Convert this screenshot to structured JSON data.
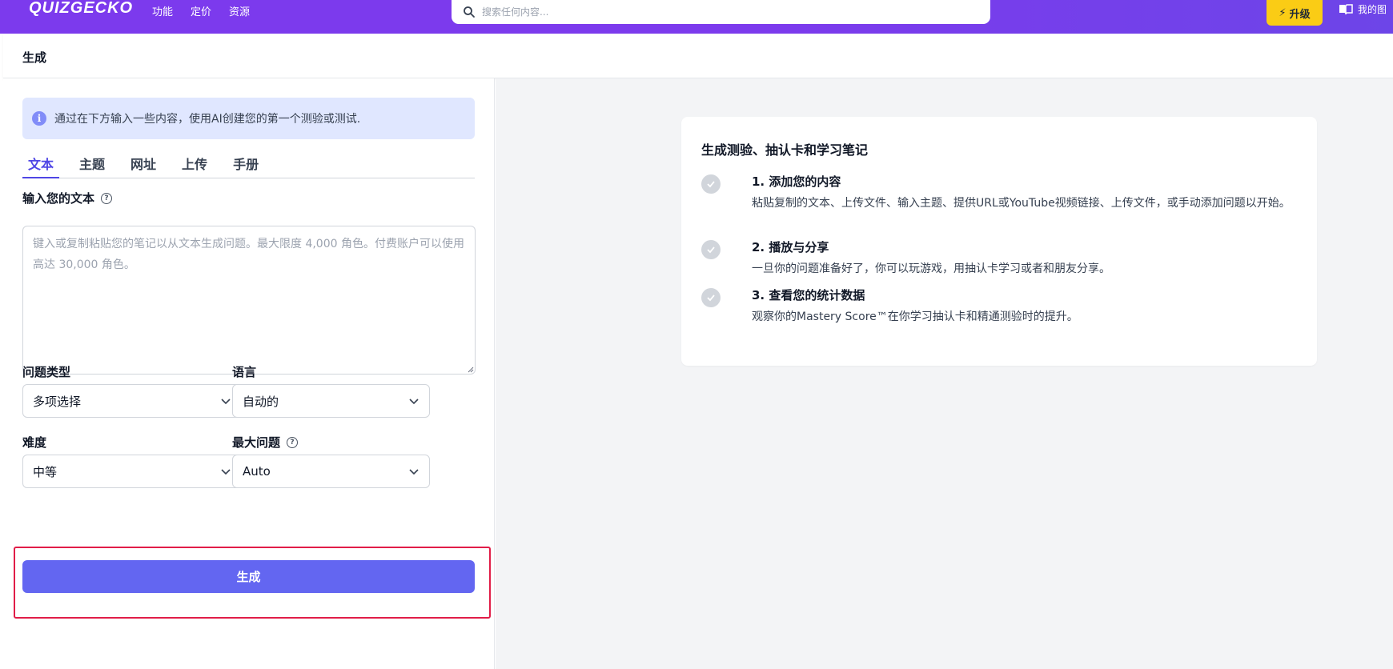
{
  "topbar": {
    "logo": "QUIZGECKO",
    "nav": [
      "功能",
      "定价",
      "资源"
    ],
    "search_placeholder": "搜索任何内容...",
    "upgrade_label": "升级",
    "my_library_label": "我的图"
  },
  "subheader": {
    "title": "生成"
  },
  "form": {
    "info_text": "通过在下方输入一些内容，使用AI创建您的第一个测验或测试.",
    "tabs": [
      "文本",
      "主题",
      "网址",
      "上传",
      "手册"
    ],
    "active_tab": "文本",
    "text_label": "输入您的文本",
    "text_placeholder": "键入或复制粘贴您的笔记以从文本生成问题。最大限度 4,000 角色。付费账户可以使用高达 30,000 角色。",
    "question_type_label": "问题类型",
    "question_type_value": "多项选择",
    "language_label": "语言",
    "language_value": "自动的",
    "difficulty_label": "难度",
    "difficulty_value": "中等",
    "max_questions_label": "最大问题",
    "max_questions_value": "Auto",
    "generate_label": "生成"
  },
  "card": {
    "title": "生成测验、抽认卡和学习笔记",
    "steps": [
      {
        "title": "1. 添加您的内容",
        "desc": "粘贴复制的文本、上传文件、输入主题、提供URL或YouTube视频链接、上传文件，或手动添加问题以开始。"
      },
      {
        "title": "2. 播放与分享",
        "desc": "一旦你的问题准备好了，你可以玩游戏，用抽认卡学习或者和朋友分享。"
      },
      {
        "title": "3. 查看您的统计数据",
        "desc": "观察你的Mastery Score™在你学习抽认卡和精通测验时的提升。"
      }
    ]
  },
  "colors": {
    "brand": "#7c3aed",
    "primary_button": "#6366f1",
    "upgrade": "#facc15",
    "highlight": "#e11d48"
  }
}
